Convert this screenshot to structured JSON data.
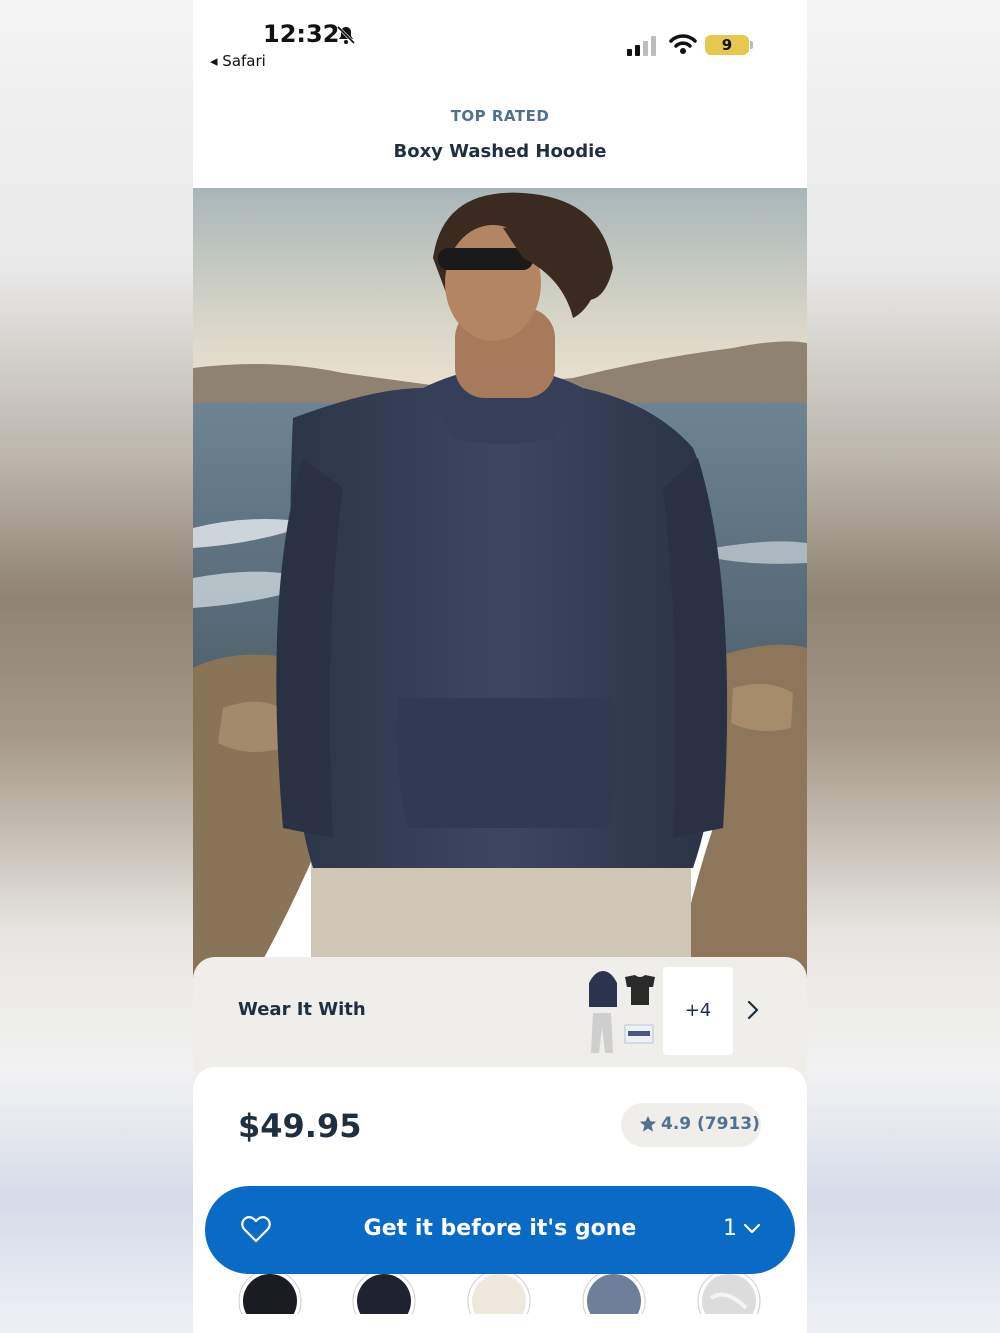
{
  "status_bar": {
    "time": "12:32",
    "back_label": "◂ Safari",
    "battery": "9",
    "icons": [
      "bell-slash-icon",
      "cell-signal-icon",
      "wifi-icon",
      "battery-icon"
    ]
  },
  "product": {
    "tag": "TOP RATED",
    "name": "Boxy Washed Hoodie",
    "price": "$49.95",
    "rating": "4.9 (7913)"
  },
  "wear_it_with": {
    "label": "Wear It With",
    "more_count": "+4",
    "thumbnails": [
      "navy-hoodie-thumb",
      "black-tee-thumb",
      "grey-sweatpants-thumb",
      "white-sneakers-thumb"
    ]
  },
  "cta": {
    "label": "Get it before it's gone",
    "quantity": "1"
  },
  "swatches": [
    {
      "name": "black",
      "color": "#1b1c22"
    },
    {
      "name": "navy",
      "color": "#1f2330"
    },
    {
      "name": "cream",
      "color": "#efe9dc"
    },
    {
      "name": "slate-blue",
      "color": "#6e7f99"
    },
    {
      "name": "marble-white",
      "color": "#dcdcdc"
    }
  ],
  "colors": {
    "accent": "#0a6bc7",
    "text_dark": "#1f2f42",
    "text_muted": "#51718e",
    "card_bg": "#efeeeb"
  }
}
